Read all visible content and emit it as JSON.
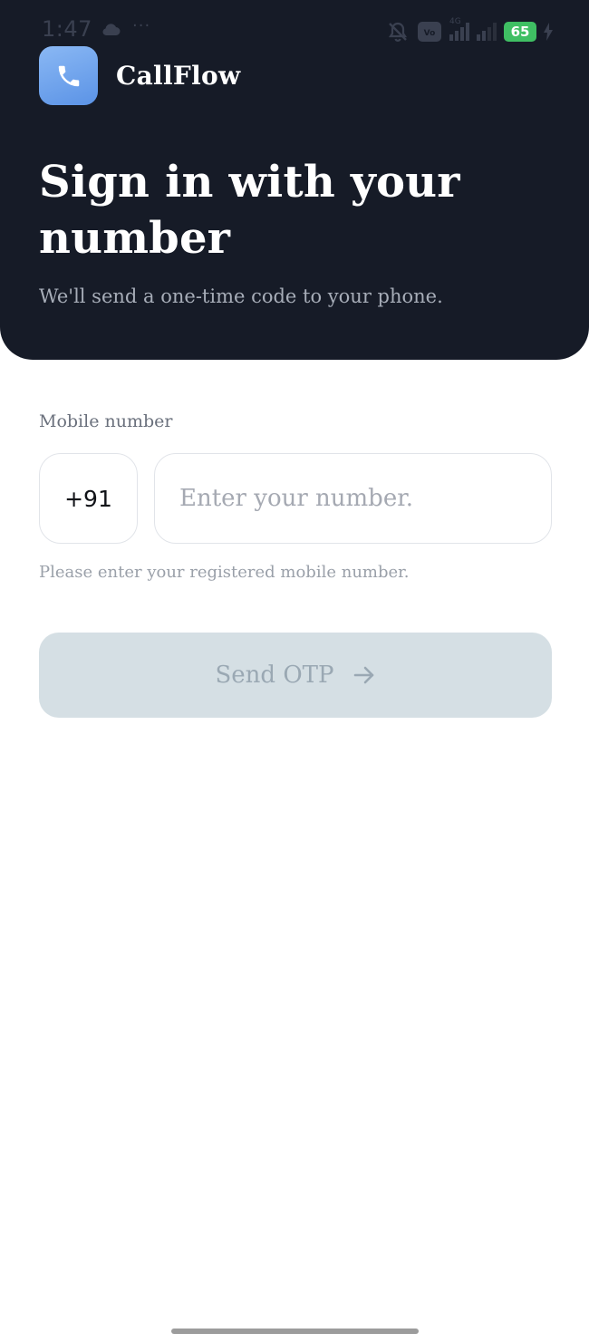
{
  "status_bar": {
    "time": "1:47",
    "dots": "···",
    "network": "4G",
    "battery": "65"
  },
  "brand": {
    "name": "CallFlow",
    "logo_icon": "phone-icon"
  },
  "header": {
    "title": "Sign in with your number",
    "subtitle": "We'll send a one-time code to your phone."
  },
  "form": {
    "label": "Mobile number",
    "country_code": "+91",
    "number_value": "",
    "number_placeholder": "Enter your number.",
    "helper": "Please enter your registered mobile number.",
    "submit_label": "Send OTP",
    "submit_icon": "arrow-right-icon"
  },
  "colors": {
    "header_bg": "#161b27",
    "brand_accent": "#5b93e6",
    "button_disabled_bg": "#d5dfe4",
    "button_disabled_text": "#9aa8b3",
    "battery": "#3fbf63"
  }
}
